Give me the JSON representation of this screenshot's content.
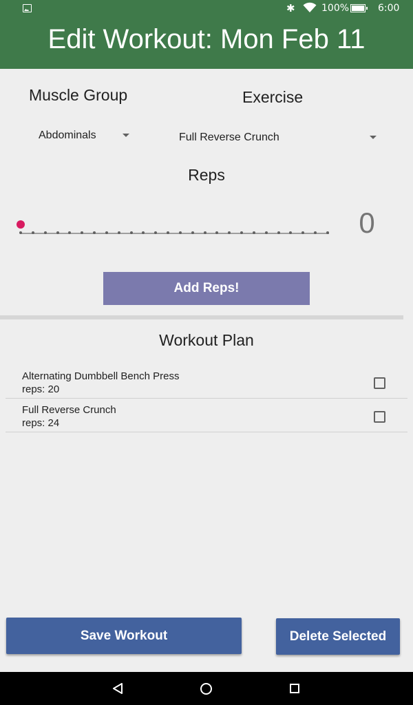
{
  "status_bar": {
    "battery_percent": "100%",
    "time": "6:00",
    "icons": [
      "image-notification-icon",
      "bluetooth-icon",
      "wifi-icon",
      "battery-icon"
    ]
  },
  "app_bar": {
    "title": "Edit Workout: Mon Feb 11",
    "color": "#3f7a4a"
  },
  "form": {
    "muscle_group_label": "Muscle Group",
    "exercise_label": "Exercise",
    "muscle_group_value": "Abdominals",
    "exercise_value": "Full Reverse Crunch",
    "reps_label": "Reps",
    "reps_value": "0",
    "add_button_label": "Add Reps!"
  },
  "plan": {
    "title": "Workout Plan",
    "items": [
      {
        "name": "Alternating Dumbbell Bench Press",
        "reps": "reps: 20"
      },
      {
        "name": "Full Reverse Crunch",
        "reps": "reps: 24"
      }
    ]
  },
  "actions": {
    "save_label": "Save Workout",
    "delete_label": "Delete Selected",
    "button_color": "#43629e"
  },
  "nav": {
    "icons": [
      "back-icon",
      "home-icon",
      "recents-icon"
    ]
  }
}
